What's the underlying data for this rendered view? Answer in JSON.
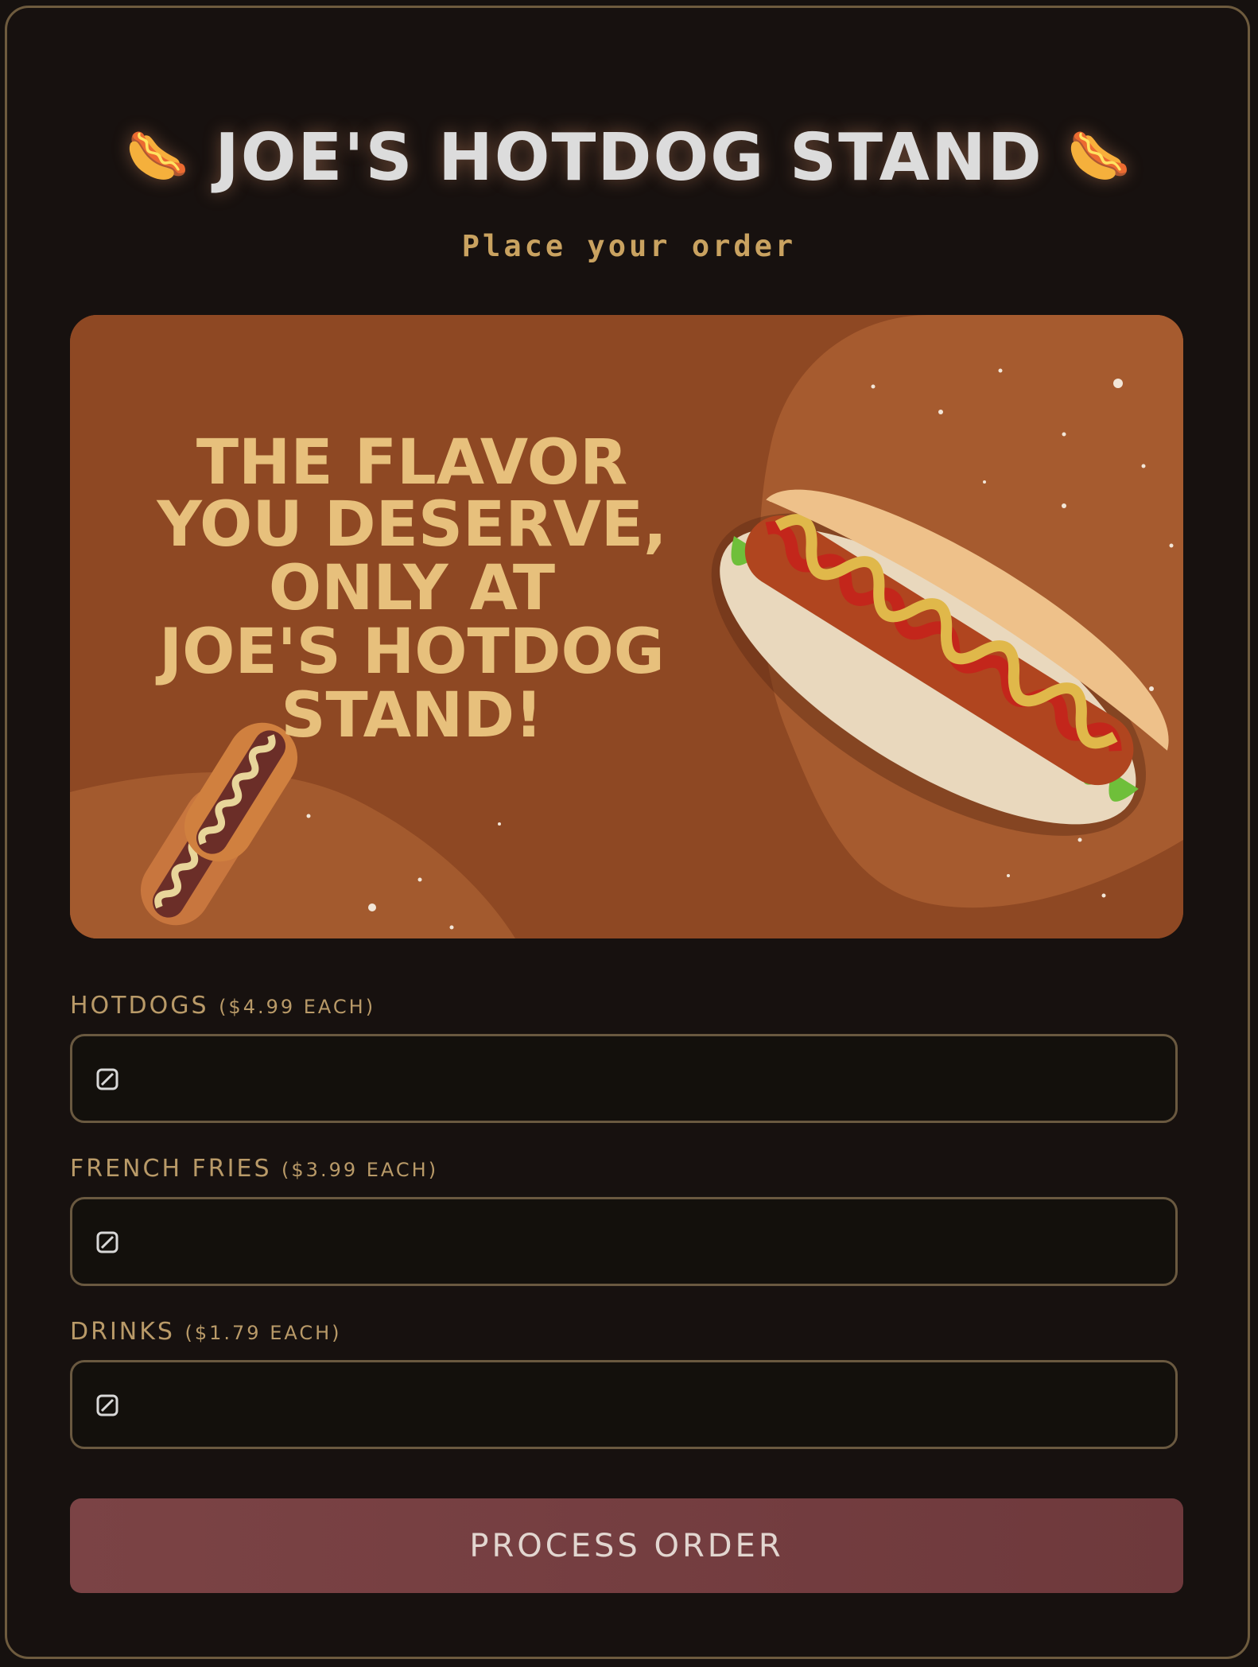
{
  "header": {
    "emoji_left": "🌭",
    "title": "JOE'S HOTDOG STAND",
    "emoji_right": "🌭",
    "subtitle": "Place your order"
  },
  "banner": {
    "headline_lines": [
      "THE FLAVOR",
      "YOU DESERVE,",
      "ONLY AT",
      "JOE'S HOTDOG",
      "STAND!"
    ]
  },
  "form": {
    "fields": [
      {
        "label": "HOTDOGS",
        "price_note": "($4.99 EACH)",
        "value": ""
      },
      {
        "label": "FRENCH FRIES",
        "price_note": "($3.99 EACH)",
        "value": ""
      },
      {
        "label": "DRINKS",
        "price_note": "($1.79 EACH)",
        "value": ""
      }
    ],
    "submit_label": "PROCESS ORDER"
  },
  "colors": {
    "background": "#17110f",
    "accent_gold": "#c9a260",
    "button": "#7b4345",
    "banner": "#8e4823"
  }
}
